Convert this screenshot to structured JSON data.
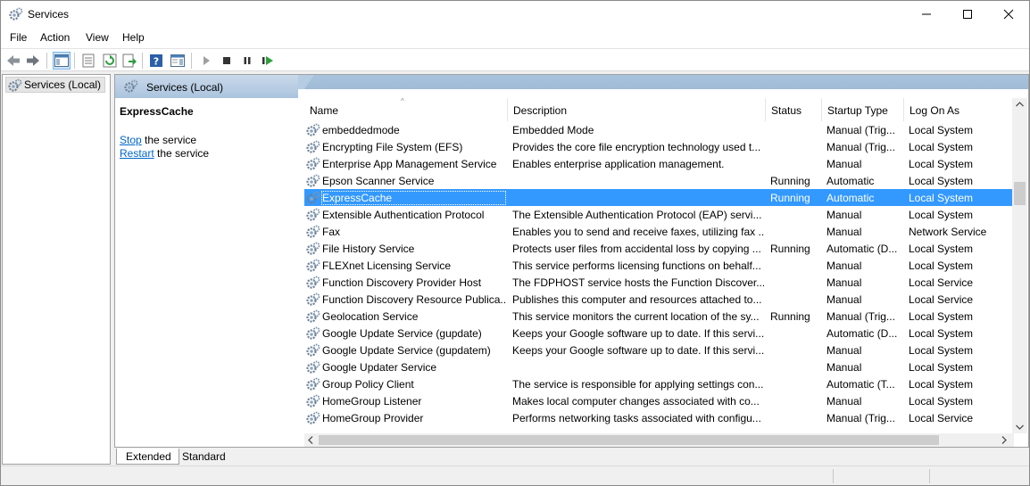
{
  "window": {
    "title": "Services"
  },
  "menu": [
    "File",
    "Action",
    "View",
    "Help"
  ],
  "tree": {
    "root_label": "Services (Local)"
  },
  "pane": {
    "header_title": "Services (Local)",
    "selected_service": "ExpressCache",
    "actions": [
      {
        "link": "Stop",
        "suffix": " the service"
      },
      {
        "link": "Restart",
        "suffix": " the service"
      }
    ]
  },
  "columns": [
    "Name",
    "Description",
    "Status",
    "Startup Type",
    "Log On As"
  ],
  "rows": [
    {
      "name": "embeddedmode",
      "description": "Embedded Mode",
      "status": "",
      "startup": "Manual (Trig...",
      "logon": "Local System"
    },
    {
      "name": "Encrypting File System (EFS)",
      "description": "Provides the core file encryption technology used t...",
      "status": "",
      "startup": "Manual (Trig...",
      "logon": "Local System"
    },
    {
      "name": "Enterprise App Management Service",
      "description": "Enables enterprise application management.",
      "status": "",
      "startup": "Manual",
      "logon": "Local System"
    },
    {
      "name": "Epson Scanner Service",
      "description": "",
      "status": "Running",
      "startup": "Automatic",
      "logon": "Local System"
    },
    {
      "name": "ExpressCache",
      "description": "",
      "status": "Running",
      "startup": "Automatic",
      "logon": "Local System",
      "selected": true
    },
    {
      "name": "Extensible Authentication Protocol",
      "description": "The Extensible Authentication Protocol (EAP) servi...",
      "status": "",
      "startup": "Manual",
      "logon": "Local System"
    },
    {
      "name": "Fax",
      "description": "Enables you to send and receive faxes, utilizing fax ...",
      "status": "",
      "startup": "Manual",
      "logon": "Network Service"
    },
    {
      "name": "File History Service",
      "description": "Protects user files from accidental loss by copying ...",
      "status": "Running",
      "startup": "Automatic (D...",
      "logon": "Local System"
    },
    {
      "name": "FLEXnet Licensing Service",
      "description": "This service performs licensing functions on behalf...",
      "status": "",
      "startup": "Manual",
      "logon": "Local System"
    },
    {
      "name": "Function Discovery Provider Host",
      "description": "The FDPHOST service hosts the Function Discover...",
      "status": "",
      "startup": "Manual",
      "logon": "Local Service"
    },
    {
      "name": "Function Discovery Resource Publica...",
      "description": "Publishes this computer and resources attached to...",
      "status": "",
      "startup": "Manual",
      "logon": "Local Service"
    },
    {
      "name": "Geolocation Service",
      "description": "This service monitors the current location of the sy...",
      "status": "Running",
      "startup": "Manual (Trig...",
      "logon": "Local System"
    },
    {
      "name": "Google Update Service (gupdate)",
      "description": "Keeps your Google software up to date. If this servi...",
      "status": "",
      "startup": "Automatic (D...",
      "logon": "Local System"
    },
    {
      "name": "Google Update Service (gupdatem)",
      "description": "Keeps your Google software up to date. If this servi...",
      "status": "",
      "startup": "Manual",
      "logon": "Local System"
    },
    {
      "name": "Google Updater Service",
      "description": "",
      "status": "",
      "startup": "Manual",
      "logon": "Local System"
    },
    {
      "name": "Group Policy Client",
      "description": "The service is responsible for applying settings con...",
      "status": "",
      "startup": "Automatic (T...",
      "logon": "Local System"
    },
    {
      "name": "HomeGroup Listener",
      "description": "Makes local computer changes associated with co...",
      "status": "",
      "startup": "Manual",
      "logon": "Local System"
    },
    {
      "name": "HomeGroup Provider",
      "description": "Performs networking tasks associated with configu...",
      "status": "",
      "startup": "Manual (Trig...",
      "logon": "Local Service"
    }
  ],
  "tabs": [
    "Extended",
    "Standard"
  ],
  "colors": {
    "selection": "#3399ff",
    "link": "#0066cc",
    "header": "#9ab6d3"
  },
  "icons": [
    "gears-icon",
    "back-icon",
    "forward-icon",
    "console-tree-icon",
    "properties-icon",
    "refresh-icon",
    "export-icon",
    "help-icon",
    "play-icon",
    "stop-icon",
    "pause-icon",
    "resume-icon"
  ]
}
